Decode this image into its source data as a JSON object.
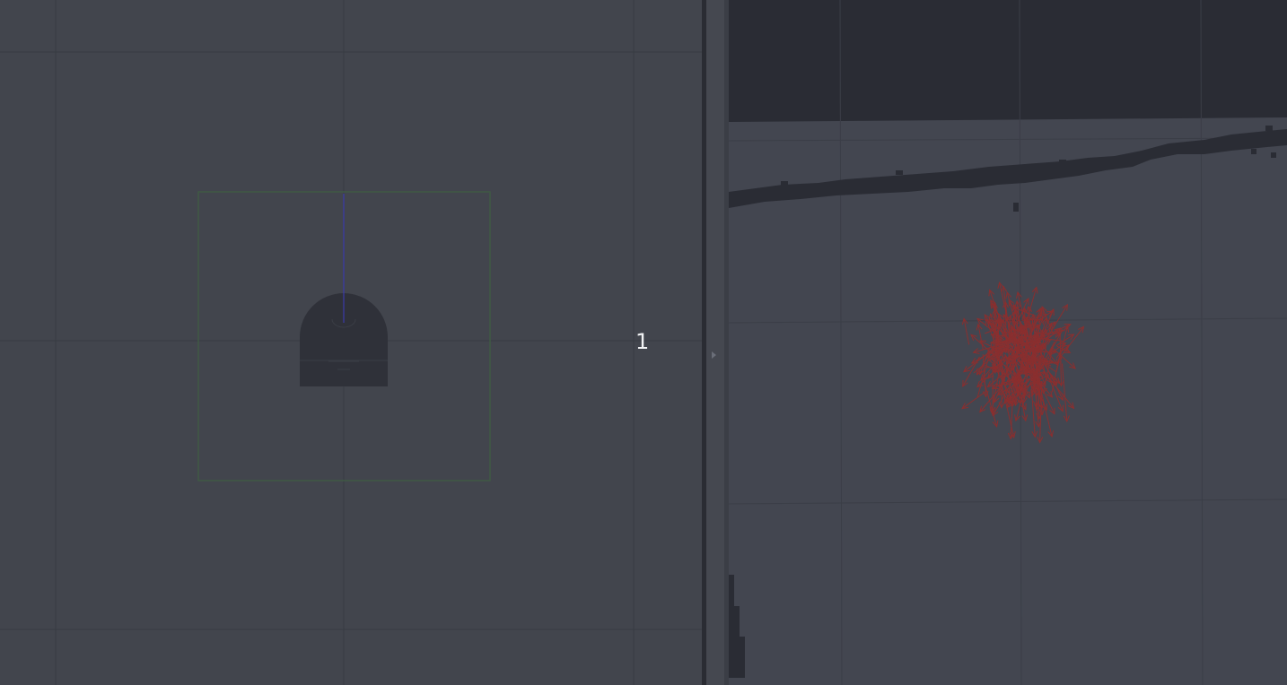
{
  "left_viewport": {
    "overlay_label": "1"
  },
  "colors": {
    "background": "#42454d",
    "grid": "#383b42",
    "robot": "#2f3139",
    "selection_box": "#3f5a44",
    "axis_z": "#3a3aa8",
    "map_unknown": "#2a2c34",
    "map_free": "#434650",
    "map_obstacle": "#2a2c34",
    "particles": "#8a2f2f"
  },
  "icons": {
    "splitter_handle": "triangle-right-icon"
  }
}
